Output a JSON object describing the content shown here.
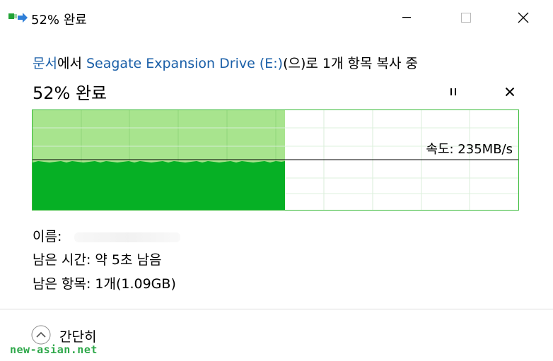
{
  "window": {
    "title": "52% 완료"
  },
  "copy_line": {
    "source": "문서",
    "from_suffix": "에서 ",
    "destination": "Seagate Expansion Drive (E:)",
    "rest": "(으)로 1개 항목 복사 중"
  },
  "progress": {
    "label": "52% 완료",
    "percent": 52
  },
  "graph": {
    "speed_text": "속도: 235MB/s",
    "fill_color": "#06b025",
    "done_color": "#a8e48e"
  },
  "details": {
    "name_label": "이름:",
    "time_left": "남은 시간: 약 5초 남음",
    "items_left": "남은 항목: 1개(1.09GB)"
  },
  "footer": {
    "collapse_label": "간단히",
    "watermark": "new-asian.net"
  }
}
